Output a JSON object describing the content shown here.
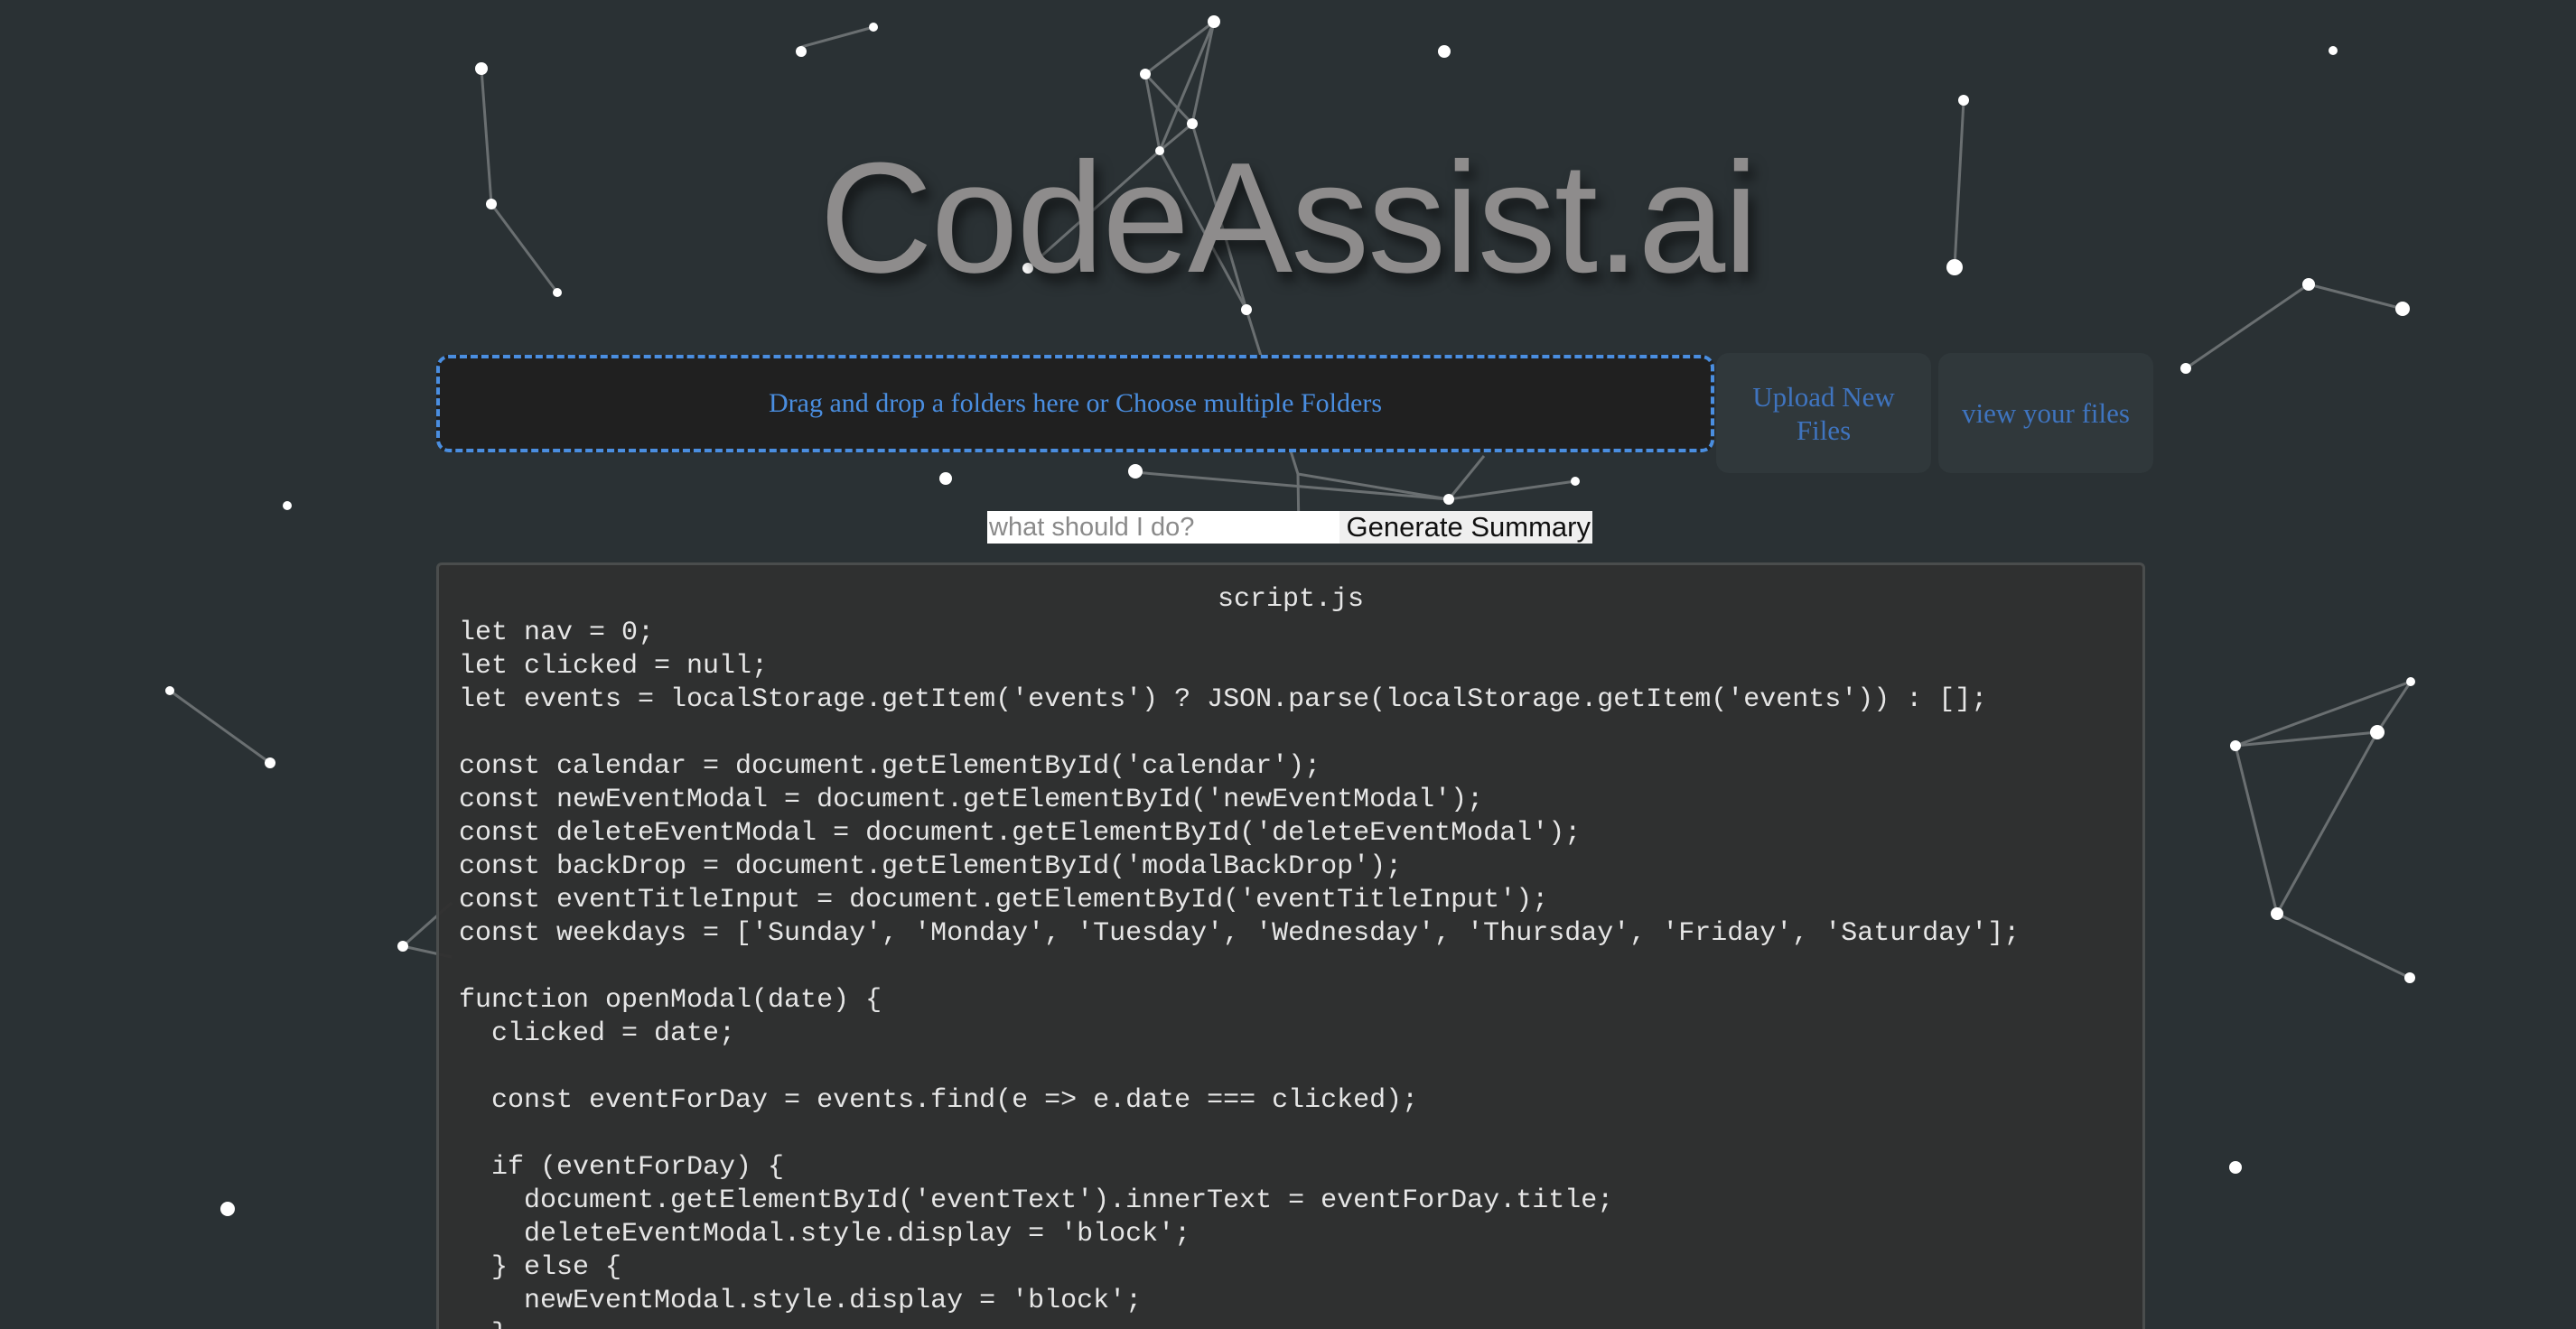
{
  "app": {
    "title": "CodeAssist.ai"
  },
  "dropzone": {
    "label": "Drag and drop a folders here or Choose multiple Folders"
  },
  "buttons": {
    "upload_new_files": "Upload New Files",
    "view_your_files": "view your files",
    "generate_summary": "Generate Summary"
  },
  "query": {
    "placeholder": "what should I do?",
    "value": ""
  },
  "code_viewer": {
    "file_name": "script.js",
    "lines": [
      "let nav = 0;",
      "let clicked = null;",
      "let events = localStorage.getItem('events') ? JSON.parse(localStorage.getItem('events')) : [];",
      "",
      "const calendar = document.getElementById('calendar');",
      "const newEventModal = document.getElementById('newEventModal');",
      "const deleteEventModal = document.getElementById('deleteEventModal');",
      "const backDrop = document.getElementById('modalBackDrop');",
      "const eventTitleInput = document.getElementById('eventTitleInput');",
      "const weekdays = ['Sunday', 'Monday', 'Tuesday', 'Wednesday', 'Thursday', 'Friday', 'Saturday'];",
      "",
      "function openModal(date) {",
      "  clicked = date;",
      "",
      "  const eventForDay = events.find(e => e.date === clicked);",
      "",
      "  if (eventForDay) {",
      "    document.getElementById('eventText').innerText = eventForDay.title;",
      "    deleteEventModal.style.display = 'block';",
      "  } else {",
      "    newEventModal.style.display = 'block';",
      "  }"
    ]
  },
  "colors": {
    "background": "#2a3134",
    "accent_blue": "#4a8ee0",
    "title_gray": "#8e8c8c",
    "code_panel": "#303030",
    "code_text": "#e6e6e6"
  }
}
